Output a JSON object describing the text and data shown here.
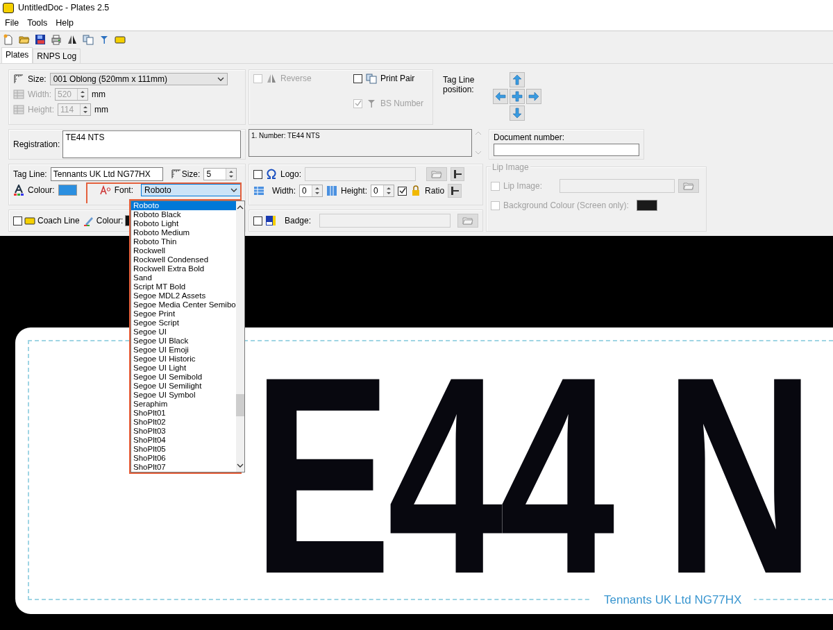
{
  "window": {
    "title": "UntitledDoc - Plates 2.5"
  },
  "menu": [
    "File",
    "Tools",
    "Help"
  ],
  "tabs": [
    {
      "label": "Plates",
      "selected": true
    },
    {
      "label": "RNPS Log",
      "selected": false
    }
  ],
  "size": {
    "label": "Size:",
    "value": "001 Oblong (520mm x 111mm)"
  },
  "width": {
    "label": "Width:",
    "value": "520",
    "unit": "mm",
    "disabled": true
  },
  "height": {
    "label": "Height:",
    "value": "114",
    "unit": "mm",
    "disabled": true
  },
  "reverse": {
    "label": "Reverse",
    "checked": false,
    "disabled": true
  },
  "print_pair": {
    "label": "Print Pair",
    "checked": false
  },
  "bs_number": {
    "label": "BS Number",
    "checked": true,
    "disabled": true
  },
  "tag_line_position": {
    "label": "Tag Line position:"
  },
  "registration": {
    "label": "Registration:",
    "value": "TE44 NTS"
  },
  "number_list": [
    "1. Number: TE44 NTS"
  ],
  "document_number": {
    "label": "Document number:"
  },
  "tag_line": {
    "label": "Tag Line:",
    "value": "Tennants UK Ltd NG77HX",
    "size_label": "Size:",
    "size_value": "5"
  },
  "tag_colour": {
    "label": "Colour:",
    "color": "#2b8fe0"
  },
  "font": {
    "label": "Font:",
    "value": "Roboto",
    "options": [
      {
        "label": "Roboto",
        "selected": true
      },
      {
        "label": "Roboto Black",
        "selected": false
      },
      {
        "label": "Roboto Light",
        "selected": false
      },
      {
        "label": "Roboto Medium",
        "selected": false
      },
      {
        "label": "Roboto Thin",
        "selected": false
      },
      {
        "label": "Rockwell",
        "selected": false
      },
      {
        "label": "Rockwell Condensed",
        "selected": false
      },
      {
        "label": "Rockwell Extra Bold",
        "selected": false
      },
      {
        "label": "Sand",
        "selected": false
      },
      {
        "label": "Script MT Bold",
        "selected": false
      },
      {
        "label": "Segoe MDL2 Assets",
        "selected": false
      },
      {
        "label": "Segoe Media Center Semibo",
        "selected": false
      },
      {
        "label": "Segoe Print",
        "selected": false
      },
      {
        "label": "Segoe Script",
        "selected": false
      },
      {
        "label": "Segoe UI",
        "selected": false
      },
      {
        "label": "Segoe UI Black",
        "selected": false
      },
      {
        "label": "Segoe UI Emoji",
        "selected": false
      },
      {
        "label": "Segoe UI Historic",
        "selected": false
      },
      {
        "label": "Segoe UI Light",
        "selected": false
      },
      {
        "label": "Segoe UI Semibold",
        "selected": false
      },
      {
        "label": "Segoe UI Semilight",
        "selected": false
      },
      {
        "label": "Segoe UI Symbol",
        "selected": false
      },
      {
        "label": "Seraphim",
        "selected": false
      },
      {
        "label": "ShoPlt01",
        "selected": false
      },
      {
        "label": "ShoPlt02",
        "selected": false
      },
      {
        "label": "ShoPlt03",
        "selected": false
      },
      {
        "label": "ShoPlt04",
        "selected": false
      },
      {
        "label": "ShoPlt05",
        "selected": false
      },
      {
        "label": "ShoPlt06",
        "selected": false
      },
      {
        "label": "ShoPlt07",
        "selected": false
      }
    ]
  },
  "coach_line": {
    "label": "Coach Line",
    "checked": false
  },
  "coach_colour": {
    "label": "Colour:"
  },
  "logo": {
    "label": "Logo:",
    "checked": false
  },
  "logo_width": {
    "label": "Width:",
    "value": "0"
  },
  "logo_height": {
    "label": "Height:",
    "value": "0"
  },
  "ratio": {
    "label": "Ratio",
    "checked": true
  },
  "badge": {
    "label": "Badge:",
    "checked": false
  },
  "lip_group": {
    "title": "Lip Image",
    "disabled": true
  },
  "lip_image": {
    "label": "Lip Image:",
    "checked": false
  },
  "background_colour": {
    "label": "Background Colour (Screen only):",
    "checked": false,
    "color": "#1a1a1a"
  },
  "plate": {
    "registration": "E44 N",
    "tag_line": "Tennants UK Ltd NG77HX"
  }
}
